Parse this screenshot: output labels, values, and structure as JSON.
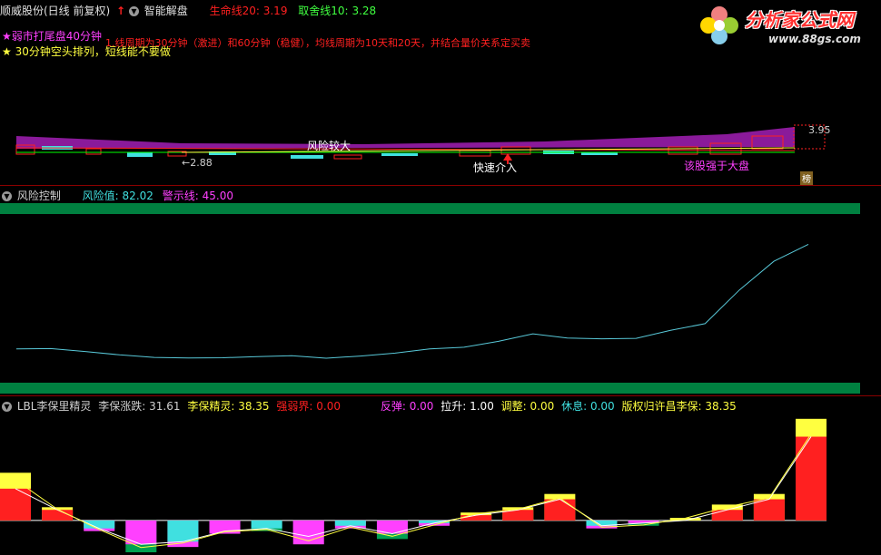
{
  "main_panel": {
    "title": "顺威股份(日线 前复权)",
    "indicator_name": "智能解盘",
    "lifeline_label": "生命线20:",
    "lifeline_value": "3.19",
    "takeline_label": "取舍线10:",
    "takeline_value": "3.28",
    "notes": [
      "★弱市打尾盘40分钟",
      "★ 30分钟空头排列，短线能不要做"
    ],
    "note_overlay": "1.线周期为30分钟（激进）和60分钟（稳健），均线周期为10天和20天，并结合量价关系定买卖",
    "annotation_risk": "风险较大",
    "annotation_low": "2.88",
    "annotation_high": "3.95",
    "annotation_enter": "快速介入",
    "annotation_strong": "该股强于大盘",
    "badge": "榜"
  },
  "logo": {
    "text": "分析家公式网",
    "url_text": "www.88gs.com"
  },
  "risk_panel": {
    "title": "风险控制",
    "risk_label": "风险值:",
    "risk_value": "82.02",
    "warn_label": "警示线:",
    "warn_value": "45.00"
  },
  "lbl_panel": {
    "title": "LBL李保里精灵",
    "items": [
      {
        "label": "李保涨跌:",
        "value": "31.61"
      },
      {
        "label": "李保精灵:",
        "value": "38.35"
      },
      {
        "label": "强弱界:",
        "value": "0.00"
      },
      {
        "label": "反弹:",
        "value": "0.00"
      },
      {
        "label": "拉升:",
        "value": "1.00"
      },
      {
        "label": "调整:",
        "value": "0.00"
      },
      {
        "label": "休息:",
        "value": "0.00"
      },
      {
        "label": "版权归许昌李保:",
        "value": "38.35"
      }
    ]
  },
  "colors": {
    "background": "#000000",
    "separator": "#8b0000",
    "red": "#ff2020",
    "yellow": "#ffff40",
    "cyan": "#40e0e0",
    "magenta": "#ff40ff",
    "green": "#00a050",
    "risk_line": "#58c8d8",
    "band": "#008040"
  },
  "chart_data": [
    {
      "type": "line",
      "series": [
        {
          "name": "风险值",
          "values": [
            20.0,
            20.2,
            18.5,
            16.5,
            15.0,
            14.6,
            14.8,
            15.5,
            16.0,
            14.5,
            15.8,
            17.5,
            20.0,
            21.0,
            24.5,
            29.0,
            26.5,
            26.0,
            26.3,
            31.0,
            35.0,
            55.0,
            72.0,
            82.02
          ]
        }
      ],
      "ylim": [
        0,
        100
      ]
    },
    {
      "type": "bar",
      "series": [
        {
          "name": "李保涨跌",
          "values": [
            12,
            4,
            -3,
            -9,
            -8,
            -4,
            -3,
            -6,
            -2,
            -5,
            -1,
            2,
            4,
            8,
            -2,
            -1,
            0,
            4,
            8,
            31.61
          ]
        },
        {
          "name": "李保精灵",
          "values": [
            18,
            5,
            -4,
            -12,
            -10,
            -5,
            -4,
            -9,
            -3,
            -7,
            -2,
            3,
            5,
            10,
            -3,
            -2,
            1,
            6,
            10,
            38.35
          ]
        }
      ],
      "ylim": [
        -12,
        40
      ]
    }
  ]
}
